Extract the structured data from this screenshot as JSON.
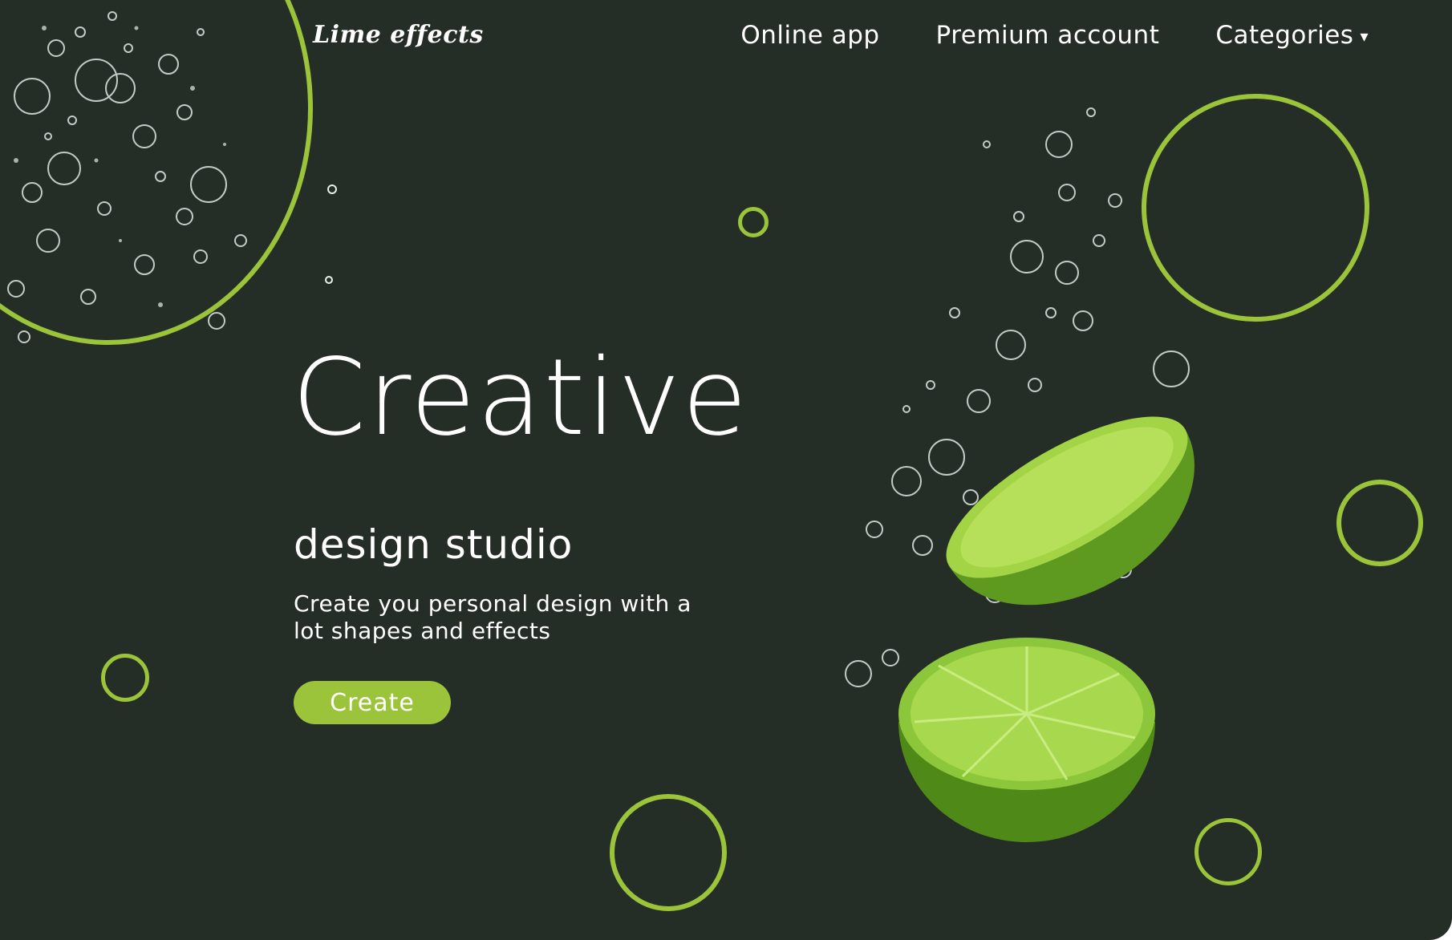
{
  "brand": {
    "logo_text": "Lime effects"
  },
  "nav": {
    "items": [
      {
        "label": "Online app"
      },
      {
        "label": "Premium account"
      },
      {
        "label": "Categories"
      }
    ],
    "dropdown_caret": "▾"
  },
  "hero": {
    "title": "Creative",
    "subtitle": "design studio",
    "description": "Create you personal design with a lot shapes and effects",
    "cta_label": "Create"
  },
  "colors": {
    "background": "#252d27",
    "accent": "#9bc43b",
    "text": "#ffffff"
  }
}
